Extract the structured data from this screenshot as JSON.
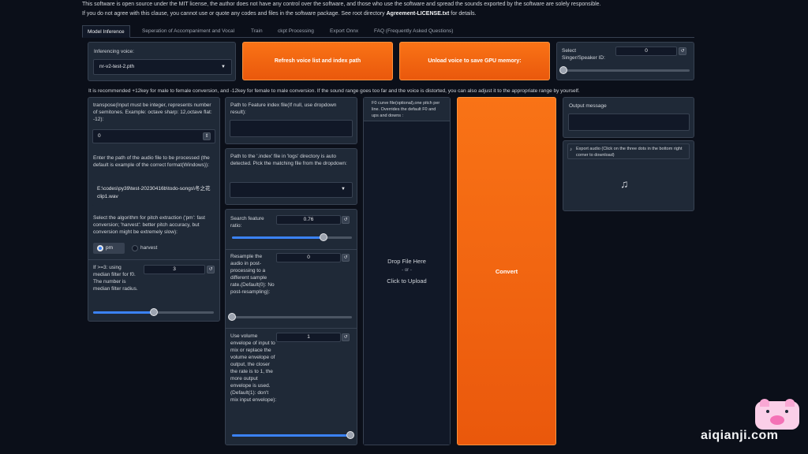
{
  "notices": {
    "line1": "This software is open source under the MIT license, the author does not have any control over the software, and those who use the software and spread the sounds exported by the software are solely responsible.",
    "line2_pre": "If you do not agree with this clause, you cannot use or quote any codes and files in the software package. See root directory ",
    "line2_bold": "Agreement-LICENSE.txt",
    "line2_post": " for details."
  },
  "tabs": [
    {
      "label": "Model Inference",
      "active": true
    },
    {
      "label": "Seperation of Accompaniment and Vocal"
    },
    {
      "label": "Train"
    },
    {
      "label": "ckpt Processing"
    },
    {
      "label": "Export Onnx"
    },
    {
      "label": "FAQ (Frequently Asked Questions)"
    }
  ],
  "voice": {
    "label": "Inferencing voice:",
    "value": "nr-v2-test-2.pth"
  },
  "buttons": {
    "refresh": "Refresh voice list and index path",
    "unload": "Unload voice to save GPU memory:",
    "convert": "Convert"
  },
  "speaker": {
    "label1": "Select",
    "label2": "Singer/Speaker ID:",
    "value": "0",
    "level": 0
  },
  "hint": "It is recommended +12key for male to female conversion, and -12key for female to male conversion. If the sound range goes too far and the voice is distorted, you can also adjust it to the appropriate range by yourself.",
  "transpose": {
    "label": "transpose(Input must be integer, represents number of semitones. Example: octave sharp: 12,octave flat: -12):",
    "value": "0"
  },
  "audio_path": {
    "label": "Enter the path of the audio file to be processed (the default is example of the correct format(Windows)):",
    "value": "E:\\codes\\py39\\test-20230416b\\todo-songs\\冬之花clip1.wav"
  },
  "pitch": {
    "label": "Select the algorithm for pitch extraction ('pm': fast conversion; 'harvest': better pitch accuracy, but conversion might be extremely slow):",
    "options": [
      "pm",
      "harvest"
    ],
    "selected": "pm"
  },
  "median": {
    "label": "If >=3: using median filter for f0. The number is median filter radius.",
    "value": "3",
    "level": 0.5
  },
  "feature_index": {
    "label": "Path to Feature index file(If null, use dropdown result):",
    "value": ""
  },
  "index_dropdown": {
    "label": "Path to the '.index' file in 'logs' directory is auto detected. Pick the matching file from the dropdown:",
    "value": ""
  },
  "search_ratio": {
    "label": "Search feature ratio:",
    "value": "0.76",
    "level": 0.76
  },
  "resample": {
    "label": "Resample the audio in post-processing to a different sample rate.(Default(0): No post-resampling):",
    "value": "0",
    "level": 0
  },
  "volume": {
    "label": "Use volume envelope of input to mix or replace the volume envelope of output, the closer the rate is to 1, the more output envelope is used.(Default(1): don't mix input envelope):",
    "value": "1",
    "level": 1
  },
  "f0_file": {
    "label": "F0 curve file(optional),one pitch per line. Overrides the default F0 and ups and downs :",
    "drop": "Drop File Here",
    "or": "- or -",
    "click": "Click to Upload"
  },
  "output": {
    "label": "Output message",
    "value": ""
  },
  "export_audio": {
    "label": "Export audio (Click on the three dots in the bottom right corner to download)",
    "icon": "music-note-icon"
  },
  "watermark": {
    "text": "aiqianji.com"
  },
  "colors": {
    "accent": "#f97316",
    "background": "#0b0f19",
    "panel": "#1f2937",
    "slider": "#3b82f6"
  }
}
